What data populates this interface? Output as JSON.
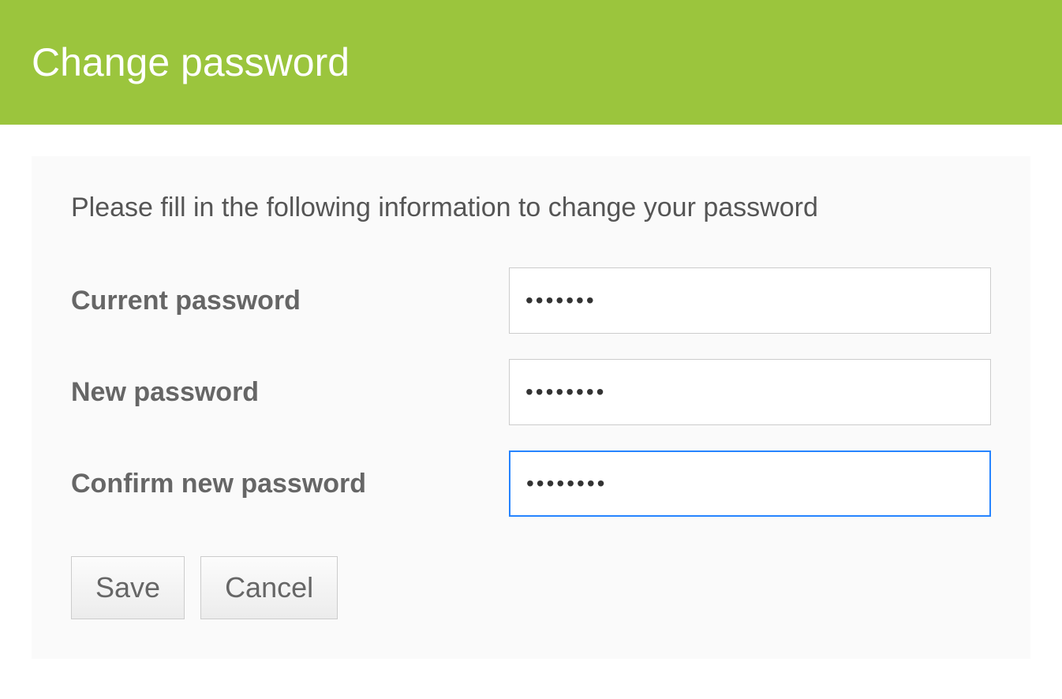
{
  "header": {
    "title": "Change password"
  },
  "form": {
    "instruction": "Please fill in the following information to change your password",
    "fields": {
      "current_password": {
        "label": "Current password",
        "value": "1234567"
      },
      "new_password": {
        "label": "New password",
        "value": "12345678"
      },
      "confirm_password": {
        "label": "Confirm new password",
        "value": "12345678"
      }
    },
    "buttons": {
      "save": "Save",
      "cancel": "Cancel"
    }
  }
}
